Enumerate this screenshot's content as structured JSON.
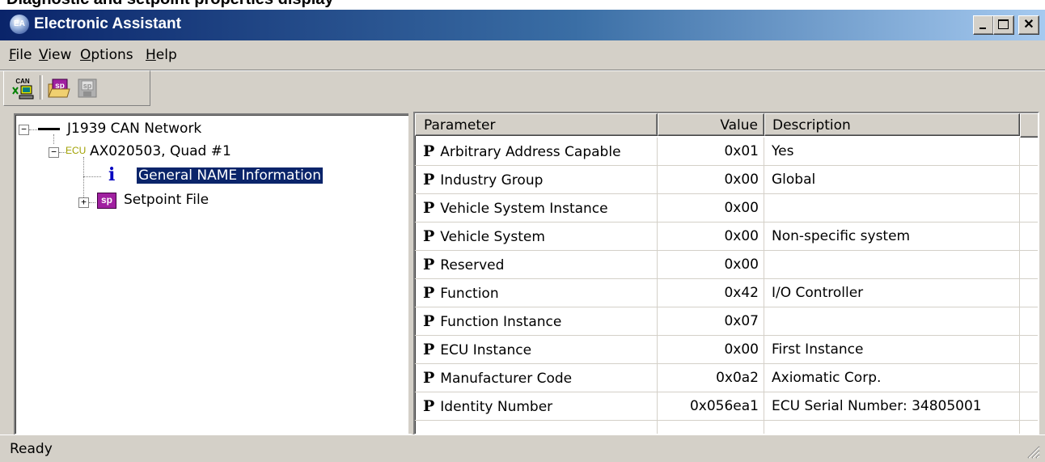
{
  "crop_caption": "Diagnostic and setpoint properties display",
  "window": {
    "title": "Electronic Assistant",
    "app_icon": "EA",
    "icons": {
      "app": "electronic-assistant-icon",
      "minimize": "minimize-icon",
      "maximize": "maximize-icon",
      "close": "close-icon"
    },
    "close_glyph": "✕"
  },
  "menu": {
    "file": {
      "accel": "F",
      "rest": "ile"
    },
    "view": {
      "accel": "V",
      "rest": "iew"
    },
    "options": {
      "accel": "O",
      "rest": "ptions"
    },
    "help": {
      "accel": "H",
      "rest": "elp"
    }
  },
  "toolbar": {
    "buttons": [
      {
        "icon": "can-network-icon",
        "text": "CAN"
      },
      {
        "icon": "open-setpoint-file-icon",
        "text": "sp"
      },
      {
        "icon": "save-setpoint-file-icon",
        "text": "sp"
      }
    ]
  },
  "tree": {
    "network": {
      "label": "J1939 CAN Network",
      "expander": "−",
      "icon": "network-line-icon"
    },
    "ecu": {
      "label": "AX020503, Quad #1",
      "expander": "−",
      "icon_text": "ECU"
    },
    "general": {
      "label": "General NAME Information",
      "icon_text": "i"
    },
    "setpoint": {
      "label": "Setpoint File",
      "expander": "+",
      "icon_text": "sp"
    }
  },
  "list": {
    "columns": {
      "parameter": "Parameter",
      "value": "Value",
      "description": "Description"
    },
    "row_icon": "P",
    "rows": [
      {
        "parameter": "Arbitrary Address Capable",
        "value": "0x01",
        "description": "Yes"
      },
      {
        "parameter": "Industry Group",
        "value": "0x00",
        "description": "Global"
      },
      {
        "parameter": "Vehicle System Instance",
        "value": "0x00",
        "description": ""
      },
      {
        "parameter": "Vehicle System",
        "value": "0x00",
        "description": "Non-specific system"
      },
      {
        "parameter": "Reserved",
        "value": "0x00",
        "description": ""
      },
      {
        "parameter": "Function",
        "value": "0x42",
        "description": "I/O Controller"
      },
      {
        "parameter": "Function Instance",
        "value": "0x07",
        "description": ""
      },
      {
        "parameter": "ECU Instance",
        "value": "0x00",
        "description": "First Instance"
      },
      {
        "parameter": "Manufacturer Code",
        "value": "0x0a2",
        "description": "Axiomatic Corp."
      },
      {
        "parameter": "Identity Number",
        "value": "0x056ea1",
        "description": "ECU Serial Number: 34805001"
      }
    ]
  },
  "status": {
    "text": "Ready",
    "grip_icon": "resize-grip-icon"
  }
}
